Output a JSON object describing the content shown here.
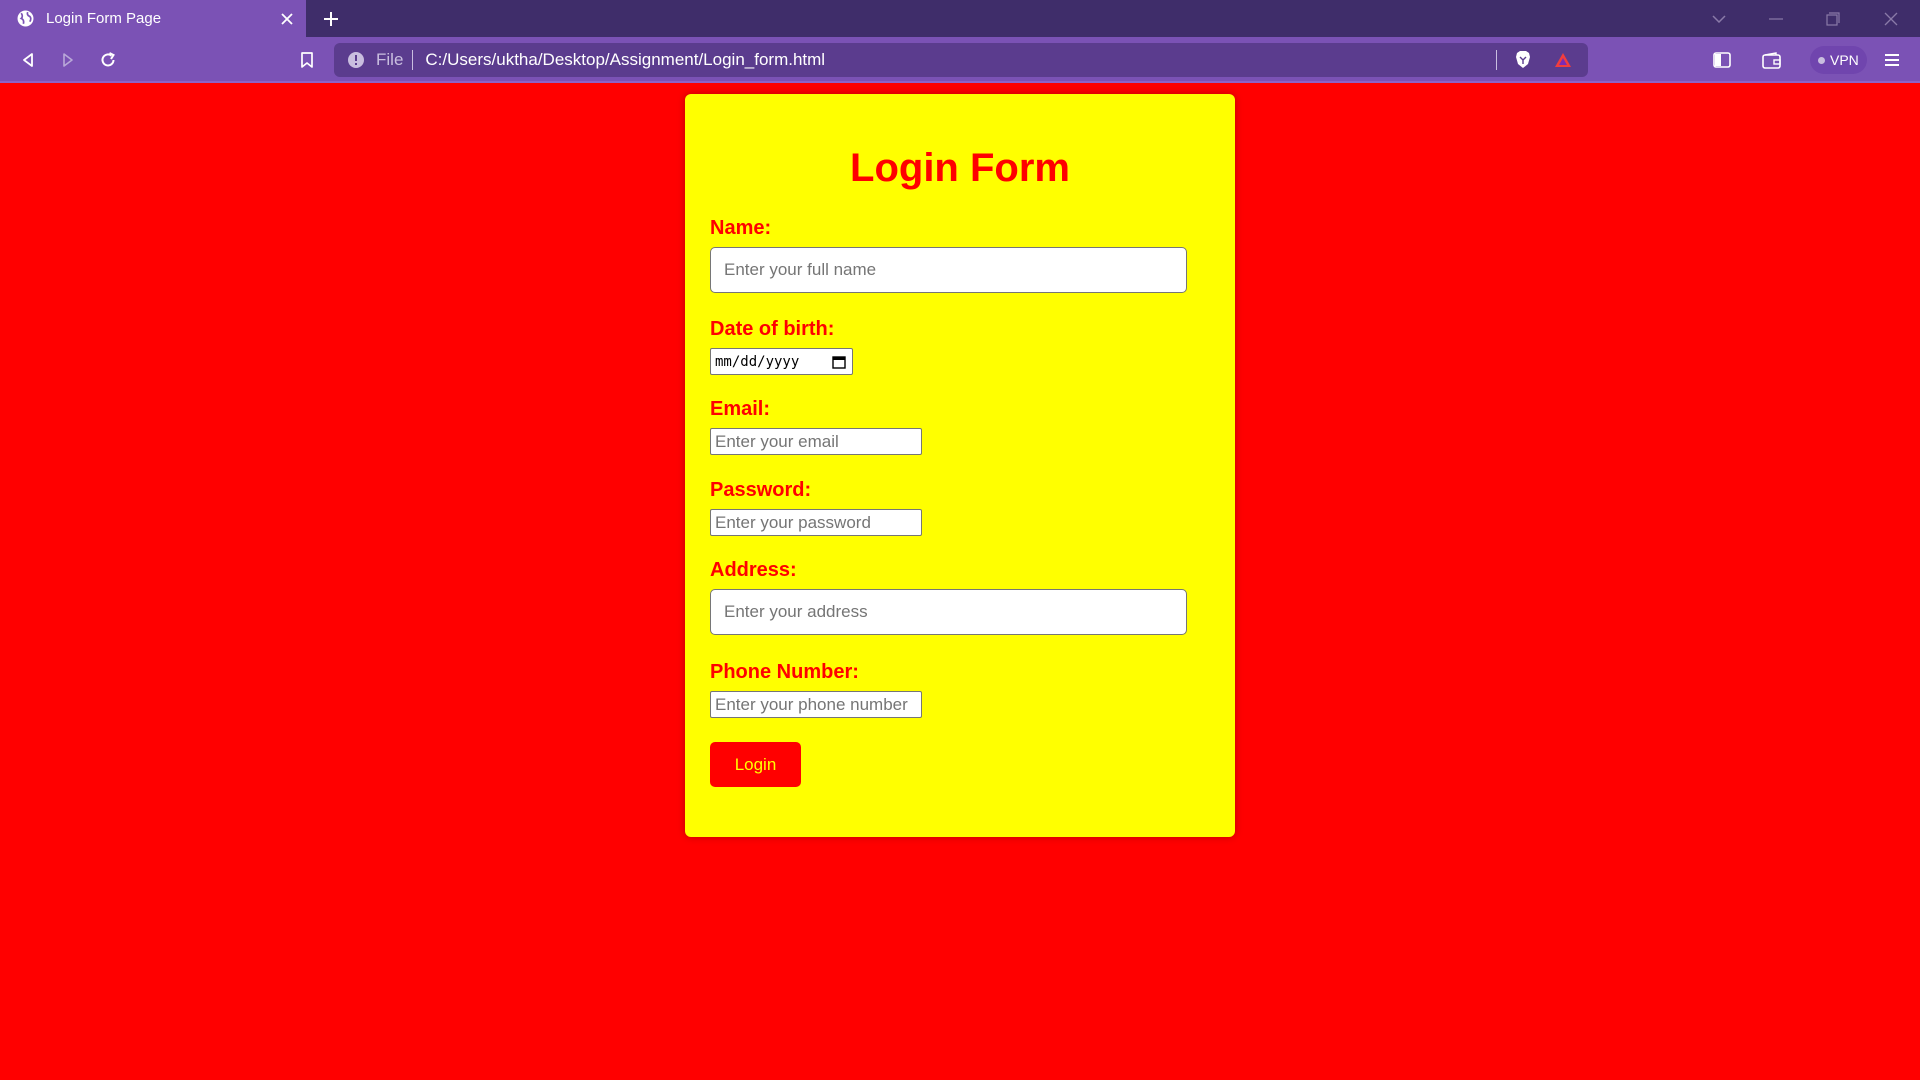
{
  "browser": {
    "tab": {
      "title": "Login Form Page"
    },
    "address": {
      "scheme_label": "File",
      "url": "C:/Users/uktha/Desktop/Assignment/Login_form.html"
    },
    "vpn_label": "VPN",
    "colors": {
      "tabbar": "#3f2d6a",
      "toolbar": "#7b52b5",
      "address_bg": "#5b3c8e"
    },
    "icons": [
      "globe-icon",
      "close-icon",
      "plus-icon",
      "back-icon",
      "forward-icon",
      "reload-icon",
      "bookmark-icon",
      "info-icon",
      "brave-shield-icon",
      "brave-rewards-icon",
      "sidebar-icon",
      "wallet-icon",
      "menu-icon",
      "minimize-icon",
      "restore-icon",
      "window-close-icon",
      "tab-search-icon"
    ]
  },
  "page": {
    "background_color": "#ff0000",
    "card_color": "#ffff00",
    "accent_color": "#ff0000",
    "form": {
      "heading": "Login Form",
      "name_label": "Name:",
      "name_placeholder": "Enter your full name",
      "dob_label": "Date of birth:",
      "dob_placeholder": "mm/dd/yyyy",
      "email_label": "Email:",
      "email_placeholder": "Enter your email",
      "password_label": "Password:",
      "password_placeholder": "Enter your password",
      "address_label": "Address:",
      "address_placeholder": "Enter your address",
      "phone_label": "Phone Number:",
      "phone_placeholder": "Enter your phone number",
      "submit_label": "Login"
    }
  }
}
